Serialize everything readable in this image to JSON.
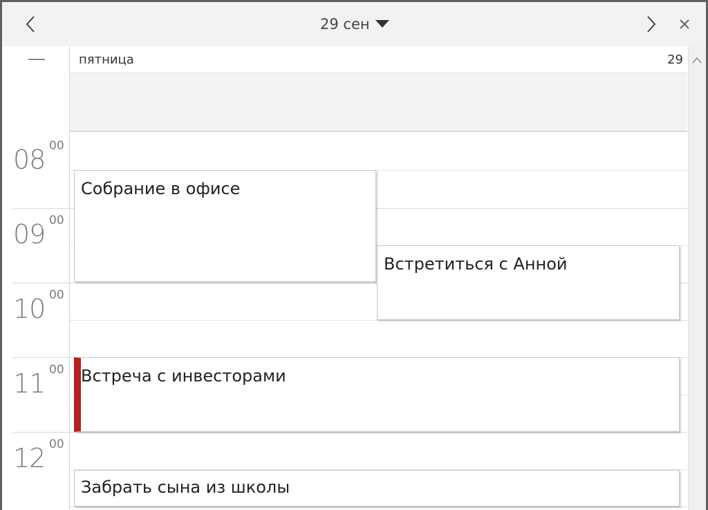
{
  "titlebar": {
    "date_label": "29 сен",
    "icons": {
      "prev": "chevron-left-icon",
      "next": "chevron-right-icon",
      "close": "close-icon",
      "dropdown": "caret-down-icon"
    }
  },
  "gutter": {
    "hours": [
      {
        "h": "08",
        "m": "00"
      },
      {
        "h": "09",
        "m": "00"
      },
      {
        "h": "10",
        "m": "00"
      },
      {
        "h": "11",
        "m": "00"
      },
      {
        "h": "12",
        "m": "00"
      }
    ]
  },
  "day": {
    "name": "пятница",
    "number": "29"
  },
  "events": [
    {
      "title": "Собрание в офисе",
      "start": "08:30",
      "end": "10:00"
    },
    {
      "title": "Встретиться с Анной",
      "start": "09:30",
      "end": "10:30"
    },
    {
      "title": "Встреча с инвесторами",
      "start": "11:00",
      "end": "12:00",
      "accent_color": "#b52020"
    },
    {
      "title": "Забрать сына из школы",
      "start": "12:30",
      "end": "13:00"
    }
  ],
  "colors": {
    "accent": "#b52020",
    "titlebar_bg": "#f2f2f2",
    "allday_bg": "#f3f3f3"
  }
}
